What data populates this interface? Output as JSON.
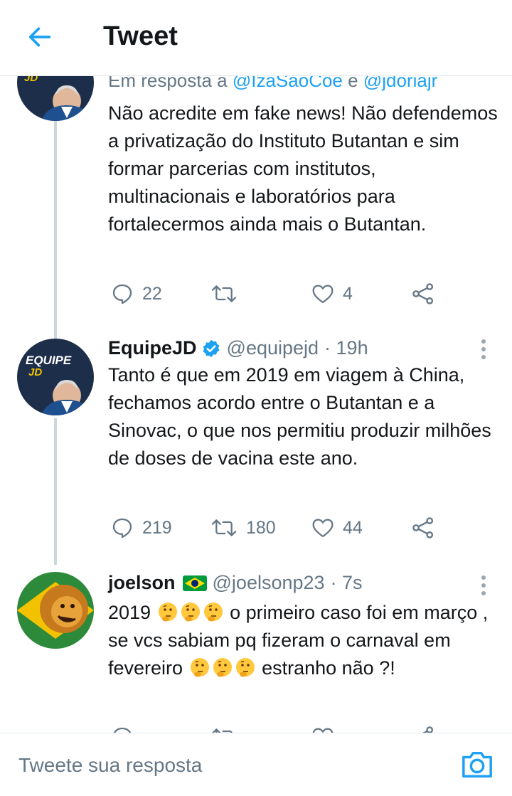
{
  "header": {
    "title": "Tweet"
  },
  "tweets": [
    {
      "reply_prefix": "Em resposta a ",
      "reply_handle_1": "@IzaSaoCoe",
      "reply_and": " e ",
      "reply_handle_2": "@jdoriajr",
      "text": "Não acredite em fake news! Não defendemos a privatização do Instituto Butantan e sim formar parcerias com institutos, multinacionais e laboratórios para fortalecermos ainda mais o Butantan.",
      "replies": "22",
      "retweets": "",
      "likes": "4"
    },
    {
      "name": "EquipeJD",
      "handle": "@equipejd",
      "time": "· 19h",
      "avatar_text_1": "EQUIPE",
      "avatar_text_2": "JD",
      "text": "Tanto é que em 2019 em viagem à China, fechamos acordo entre o Butantan e a Sinovac, o que nos permitiu produzir milhões de doses de vacina este ano.",
      "replies": "219",
      "retweets": "180",
      "likes": "44"
    },
    {
      "name": "joelson",
      "handle": "@joelsonp23",
      "time": "· 7s",
      "text_1": "2019",
      "text_2": "o primeiro caso foi em março , se vcs sabiam pq fizeram o carnaval em fevereiro",
      "text_3": "estranho não ?!"
    }
  ],
  "reply_bar": {
    "placeholder": "Tweete sua resposta"
  },
  "colors": {
    "accent": "#1da1f2",
    "verified": "#1da1f2",
    "muted": "#657786"
  },
  "icons": [
    "back-arrow-icon",
    "reply-icon",
    "retweet-icon",
    "like-icon",
    "share-icon",
    "more-icon",
    "verified-badge-icon",
    "brazil-flag-icon",
    "thinking-face-emoji",
    "camera-icon"
  ]
}
